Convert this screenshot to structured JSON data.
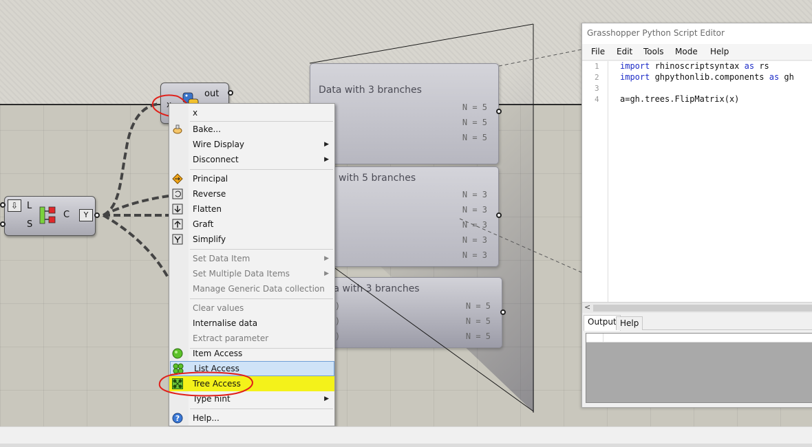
{
  "canvas": {
    "python_component": {
      "input": "x",
      "output": "out"
    },
    "merge_component": {
      "inputs": [
        "L",
        "S"
      ],
      "output": "C"
    },
    "panels": [
      {
        "title": "Data with 3 branches",
        "rows": [
          "N = 5",
          "N = 5",
          "N = 5"
        ]
      },
      {
        "title": "a with 5 branches",
        "rows": [
          "N = 3",
          "N = 3",
          "N = 3",
          "N = 3",
          "N = 3"
        ]
      },
      {
        "title": "ta with 3 branches",
        "rows": [
          "N = 5",
          "N = 5",
          "N = 5"
        ],
        "left_marks": [
          ")",
          ")",
          ")"
        ]
      }
    ]
  },
  "context_menu": {
    "header": "x",
    "items": [
      {
        "label": "Bake...",
        "icon": "bake-icon",
        "enabled": true
      },
      {
        "label": "Wire Display",
        "submenu": true,
        "enabled": true
      },
      {
        "label": "Disconnect",
        "submenu": true,
        "enabled": true
      },
      {
        "label": "Principal",
        "icon": "principal-icon",
        "enabled": true
      },
      {
        "label": "Reverse",
        "icon": "reverse-icon",
        "enabled": true
      },
      {
        "label": "Flatten",
        "icon": "flatten-icon",
        "enabled": true
      },
      {
        "label": "Graft",
        "icon": "graft-icon",
        "enabled": true
      },
      {
        "label": "Simplify",
        "icon": "simplify-icon",
        "enabled": true
      },
      {
        "label": "Set Data Item",
        "submenu": true,
        "enabled": false
      },
      {
        "label": "Set Multiple Data Items",
        "submenu": true,
        "enabled": false
      },
      {
        "label": "Manage Generic Data collection",
        "enabled": false
      },
      {
        "label": "Clear values",
        "enabled": false
      },
      {
        "label": "Internalise data",
        "enabled": true
      },
      {
        "label": "Extract parameter",
        "enabled": false
      },
      {
        "label": "Item Access",
        "icon": "item-access-icon",
        "enabled": true
      },
      {
        "label": "List Access",
        "icon": "list-access-icon",
        "enabled": true,
        "highlighted": true
      },
      {
        "label": "Tree Access",
        "icon": "tree-access-icon",
        "enabled": true
      },
      {
        "label": "Type hint",
        "submenu": true,
        "enabled": true
      },
      {
        "label": "Help...",
        "icon": "help-icon",
        "enabled": true
      }
    ]
  },
  "editor": {
    "title": "Grasshopper Python Script Editor",
    "menu": [
      "File",
      "Edit",
      "Tools",
      "Mode",
      "Help"
    ],
    "line_numbers": [
      "1",
      "2",
      "3",
      "4"
    ],
    "code": {
      "l1_kw1": "import",
      "l1_mid": " rhinoscriptsyntax ",
      "l1_kw2": "as",
      "l1_end": " rs",
      "l2_kw1": "import",
      "l2_mid": " ghpythonlib.components ",
      "l2_kw2": "as",
      "l2_end": " gh",
      "l4": "a=gh.trees.FlipMatrix(x)"
    },
    "scroll_left": "<",
    "tabs": [
      "Output",
      "Help"
    ]
  },
  "colors": {
    "menu_highlight": "#cfe3f7",
    "annotation_red": "#e0201a",
    "annotation_yellow": "#f4f21a",
    "code_keyword": "#1d2cc7"
  }
}
